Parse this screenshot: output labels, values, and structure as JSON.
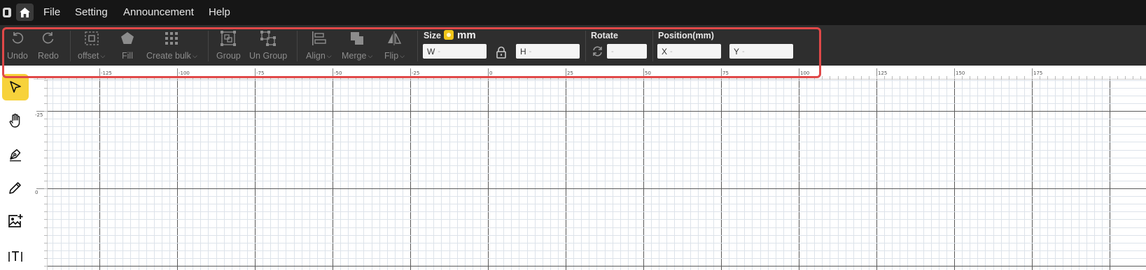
{
  "menubar": {
    "items": [
      "File",
      "Setting",
      "Announcement",
      "Help"
    ]
  },
  "toolbar": {
    "undo": "Undo",
    "redo": "Redo",
    "offset": "offset",
    "fill": "Fill",
    "create_bulk": "Create bulk",
    "group": "Group",
    "ungroup": "Un Group",
    "align": "Align",
    "merge": "Merge",
    "flip": "Flip",
    "size_label": "Size",
    "unit": "mm",
    "width_prefix": "W",
    "height_prefix": "H",
    "empty_value": "-",
    "rotate_label": "Rotate",
    "position_label": "Position(mm)",
    "x_prefix": "X",
    "y_prefix": "Y",
    "accent_color": "#f7d23b",
    "highlight_color": "#e04848"
  },
  "left_tools": [
    {
      "name": "select-tool",
      "icon": "cursor-arrow-icon",
      "active": true
    },
    {
      "name": "pan-tool",
      "icon": "hand-icon",
      "active": false
    },
    {
      "name": "pen-tool",
      "icon": "pen-nib-icon",
      "active": false
    },
    {
      "name": "pencil-tool",
      "icon": "pencil-icon",
      "active": false
    },
    {
      "name": "image-tool",
      "icon": "image-add-icon",
      "active": false
    },
    {
      "name": "text-tool",
      "icon": "text-icon",
      "active": false
    }
  ],
  "rulers": {
    "horizontal_labels": [
      "-125",
      "-100",
      "-75",
      "-50",
      "-25",
      "0",
      "25",
      "50",
      "75",
      "100",
      "125",
      "150",
      "175"
    ],
    "vertical_labels": [
      "-25",
      "0"
    ]
  }
}
